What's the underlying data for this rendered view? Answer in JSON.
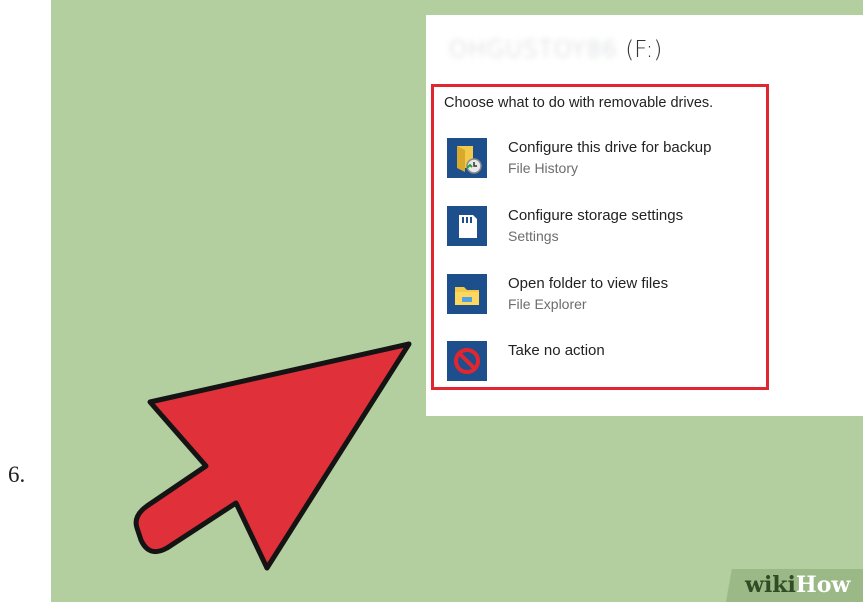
{
  "step": {
    "number": "6."
  },
  "dialog": {
    "drive_name": "OHGUSTOY86",
    "drive_letter": "(F:)",
    "prompt": "Choose what to do with removable drives.",
    "options": [
      {
        "title": "Configure this drive for backup",
        "subtitle": "File History",
        "icon": "file-history-icon"
      },
      {
        "title": "Configure storage settings",
        "subtitle": "Settings",
        "icon": "sd-card-icon"
      },
      {
        "title": "Open folder to view files",
        "subtitle": "File Explorer",
        "icon": "folder-icon"
      },
      {
        "title": "Take no action",
        "subtitle": "",
        "icon": "no-action-icon"
      }
    ]
  },
  "watermark": {
    "part1": "wiki",
    "part2": "How"
  },
  "colors": {
    "background": "#b4cf9f",
    "highlight": "#e2262f",
    "arrow": "#e0303a",
    "icon_tile": "#1d4f8c"
  }
}
